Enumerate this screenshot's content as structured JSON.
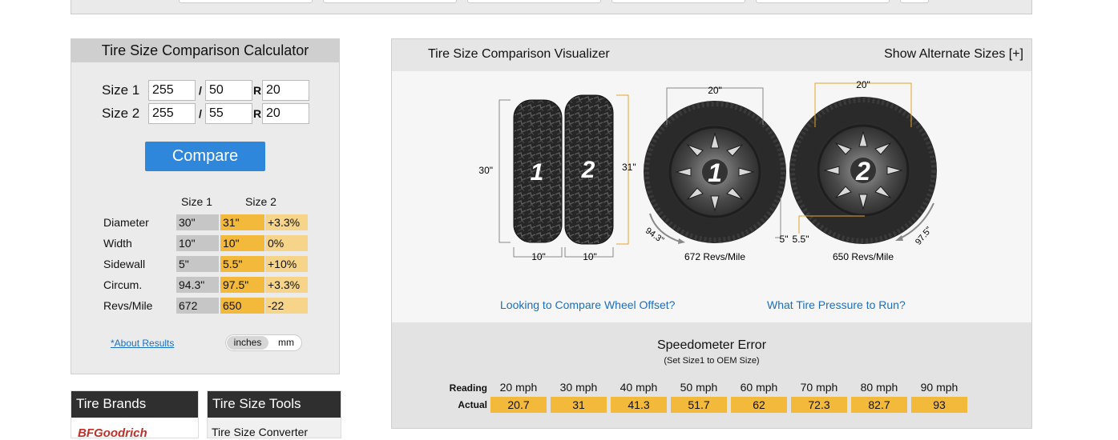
{
  "calculator": {
    "title": "Tire Size Comparison Calculator",
    "size1": {
      "label": "Size 1",
      "width": "255",
      "aspect": "50",
      "rim": "20"
    },
    "size2": {
      "label": "Size 2",
      "width": "255",
      "aspect": "55",
      "rim": "20"
    },
    "slash": "/",
    "r_label": "R",
    "compare_label": "Compare",
    "results": {
      "col1": "Size 1",
      "col2": "Size 2",
      "rows": [
        {
          "label": "Diameter",
          "size1": "30\"",
          "size2": "31\"",
          "diff": "+3.3%"
        },
        {
          "label": "Width",
          "size1": "10\"",
          "size2": "10\"",
          "diff": "0%"
        },
        {
          "label": "Sidewall",
          "size1": "5\"",
          "size2": "5.5\"",
          "diff": "+10%"
        },
        {
          "label": "Circum.",
          "size1": "94.3\"",
          "size2": "97.5\"",
          "diff": "+3.3%"
        },
        {
          "label": "Revs/Mile",
          "size1": "672",
          "size2": "650",
          "diff": "-22"
        }
      ]
    },
    "about_link": "*About Results",
    "units": {
      "inches": "inches",
      "mm": "mm",
      "selected": "inches"
    }
  },
  "sidebar": {
    "brands_title": "Tire Brands",
    "brand_first": "BFGoodrich",
    "tools_title": "Tire Size Tools",
    "tools_first": "Tire Size Converter"
  },
  "visualizer": {
    "title": "Tire Size Comparison Visualizer",
    "alt_sizes": "Show Alternate Sizes [+]",
    "tread": {
      "tire1_num": "1",
      "tire2_num": "2",
      "height1": "30\"",
      "height2": "31\"",
      "width1": "10\"",
      "width2": "10\""
    },
    "wheel1": {
      "num": "1",
      "rim": "20\"",
      "sidewall": "5\"",
      "circ": "94.3\"",
      "revs": "672 Revs/Mile"
    },
    "wheel2": {
      "num": "2",
      "rim": "20\"",
      "sidewall": "5.5\"",
      "circ": "97.5\"",
      "revs": "650 Revs/Mile"
    },
    "links": {
      "offset": "Looking to Compare Wheel Offset?",
      "pressure": "What Tire Pressure to Run?"
    }
  },
  "speedometer": {
    "title": "Speedometer Error",
    "subtitle": "(Set Size1 to OEM Size)",
    "reading_label": "Reading",
    "actual_label": "Actual",
    "readings": [
      "20 mph",
      "30 mph",
      "40 mph",
      "50 mph",
      "60 mph",
      "70 mph",
      "80 mph",
      "90 mph"
    ],
    "actuals": [
      "20.7",
      "31",
      "41.3",
      "51.7",
      "62",
      "72.3",
      "82.7",
      "93"
    ]
  },
  "colors": {
    "accent": "#2f87dc",
    "size2_fill": "#f2b93b",
    "diff_fill": "#f6d48a",
    "size1_fill": "#c6c6c6",
    "link": "#1a6fc2"
  }
}
